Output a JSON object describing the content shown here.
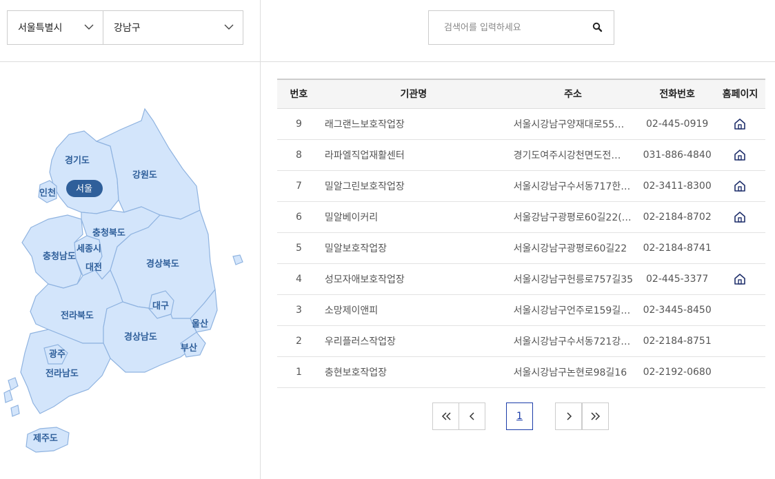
{
  "filters": {
    "city": "서울특별시",
    "district": "강남구"
  },
  "search": {
    "placeholder": "검색어를 입력하세요",
    "value": ""
  },
  "map": {
    "selected_region": "서울",
    "regions": {
      "gyeonggi": "경기도",
      "seoul": "서울",
      "incheon": "인천",
      "gangwon": "강원도",
      "chungbuk": "충청북도",
      "sejong": "세종시",
      "chungnam": "충청남도",
      "daejeon": "대전",
      "gyeongbuk": "경상북도",
      "daegu": "대구",
      "jeonbuk": "전라북도",
      "ulsan": "울산",
      "gyeongnam": "경상남도",
      "busan": "부산",
      "gwangju": "광주",
      "jeonnam": "전라남도",
      "jeju": "제주도"
    },
    "colors": {
      "region_fill": "#d3e5fb",
      "region_stroke": "#8fb3e0",
      "label": "#2f5f9a",
      "selected_pill": "#2f5f9a"
    }
  },
  "table": {
    "headers": {
      "num": "번호",
      "name": "기관명",
      "addr": "주소",
      "tel": "전화번호",
      "home": "홈페이지"
    },
    "rows": [
      {
        "num": "9",
        "name": "래그랜느보호작업장",
        "addr": "서울시강남구양재대로55…",
        "tel": "02-445-0919",
        "home": true
      },
      {
        "num": "8",
        "name": "라파엘직업재활센터",
        "addr": "경기도여주시강천면도전…",
        "tel": "031-886-4840",
        "home": true
      },
      {
        "num": "7",
        "name": "밀알그린보호작업장",
        "addr": "서울시강남구수서동717한…",
        "tel": "02-3411-8300",
        "home": true
      },
      {
        "num": "6",
        "name": "밀알베이커리",
        "addr": "서울강남구광평로60길22(…",
        "tel": "02-2184-8702",
        "home": true
      },
      {
        "num": "5",
        "name": "밀알보호작업장",
        "addr": "서울시강남구광평로60길22",
        "tel": "02-2184-8741",
        "home": false
      },
      {
        "num": "4",
        "name": "성모자애보호작업장",
        "addr": "서울시강남구헌릉로757길35",
        "tel": "02-445-3377",
        "home": true
      },
      {
        "num": "3",
        "name": "소망제이앤피",
        "addr": "서울시강남구언주로159길…",
        "tel": "02-3445-8450",
        "home": false
      },
      {
        "num": "2",
        "name": "우리플러스작업장",
        "addr": "서울시강남구수서동721강…",
        "tel": "02-2184-8751",
        "home": false
      },
      {
        "num": "1",
        "name": "충현보호작업장",
        "addr": "서울시강남구논현로98길16",
        "tel": "02-2192-0680",
        "home": false
      }
    ]
  },
  "pagination": {
    "first": "«",
    "prev": "‹",
    "current": "1",
    "next": "›",
    "last": "»"
  },
  "icons": {
    "chevron": "chevron-down-icon",
    "search": "search-icon",
    "home": "home-icon",
    "accent_color": "#1a3ba8"
  }
}
